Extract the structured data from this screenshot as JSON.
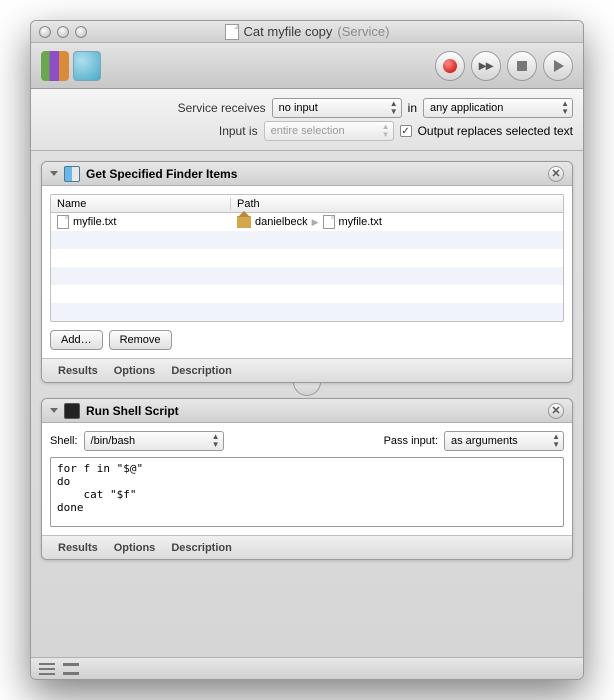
{
  "window": {
    "title": "Cat myfile copy",
    "title_suffix": "(Service)"
  },
  "config": {
    "receives_label": "Service receives",
    "receives_value": "no input",
    "in_label": "in",
    "in_value": "any application",
    "input_is_label": "Input is",
    "input_is_value": "entire selection",
    "replaces_checked": true,
    "replaces_label": "Output replaces selected text"
  },
  "action1": {
    "title": "Get Specified Finder Items",
    "columns": {
      "name": "Name",
      "path": "Path"
    },
    "row": {
      "name": "myfile.txt",
      "path_home": "danielbeck",
      "path_file": "myfile.txt"
    },
    "add_btn": "Add…",
    "remove_btn": "Remove"
  },
  "action2": {
    "title": "Run Shell Script",
    "shell_label": "Shell:",
    "shell_value": "/bin/bash",
    "pass_label": "Pass input:",
    "pass_value": "as arguments",
    "code": "for f in \"$@\"\ndo\n    cat \"$f\"\ndone"
  },
  "footer": {
    "results": "Results",
    "options": "Options",
    "description": "Description"
  }
}
